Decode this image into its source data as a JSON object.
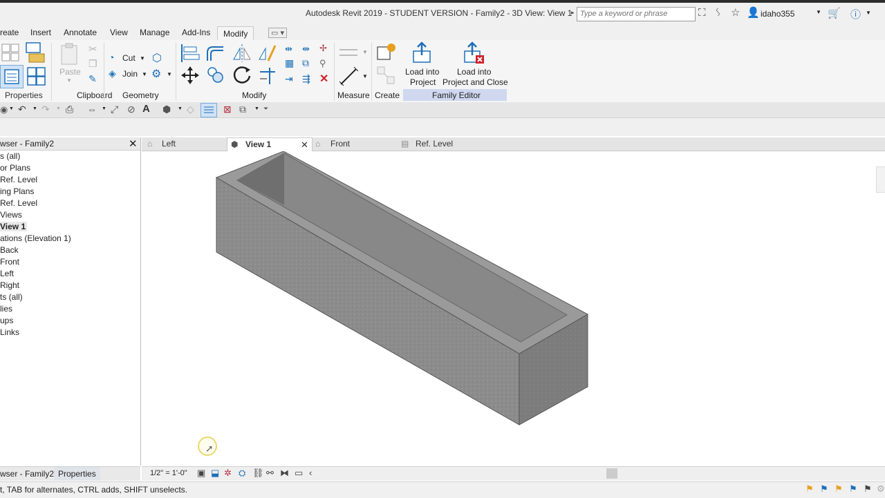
{
  "titlebar": {
    "title": "Autodesk Revit 2019 - STUDENT VERSION - Family2 - 3D View: View 1",
    "search_placeholder": "Type a keyword or phrase",
    "user": "idaho355"
  },
  "ribbon_tabs": [
    "reate",
    "Insert",
    "Annotate",
    "View",
    "Manage",
    "Add-Ins",
    "Modify"
  ],
  "ribbon": {
    "paste": "Paste",
    "cut": "Cut",
    "join": "Join",
    "load_into_project_line1": "Load into",
    "load_into_project_line2": "Project",
    "load_close_line1": "Load into",
    "load_close_line2": "Project and Close",
    "panels": {
      "properties": "Properties",
      "clipboard": "Clipboard",
      "geometry": "Geometry",
      "modify": "Modify",
      "measure": "Measure",
      "create": "Create",
      "family_editor": "Family Editor"
    }
  },
  "browser": {
    "title": "wser - Family2",
    "items": [
      "s (all)",
      "or Plans",
      "Ref. Level",
      "ing Plans",
      "Ref. Level",
      "Views",
      "View 1",
      "ations (Elevation 1)",
      "Back",
      "Front",
      "Left",
      "Right",
      "ts (all)",
      "lies",
      "ups",
      "Links"
    ],
    "bottom_tabs": [
      "wser - Family2",
      "Properties"
    ]
  },
  "view_tabs": [
    {
      "label": "Left"
    },
    {
      "label": "View 1"
    },
    {
      "label": "Front"
    },
    {
      "label": "Ref. Level"
    }
  ],
  "view_control": {
    "scale": "1/2\" = 1'-0\""
  },
  "status": {
    "text": "t, TAB for alternates, CTRL adds, SHIFT unselects."
  },
  "colors": {
    "accent": "#1d6fb8",
    "family_editor_bg": "#cfd8ef",
    "model_face": "#8f8f8f"
  }
}
